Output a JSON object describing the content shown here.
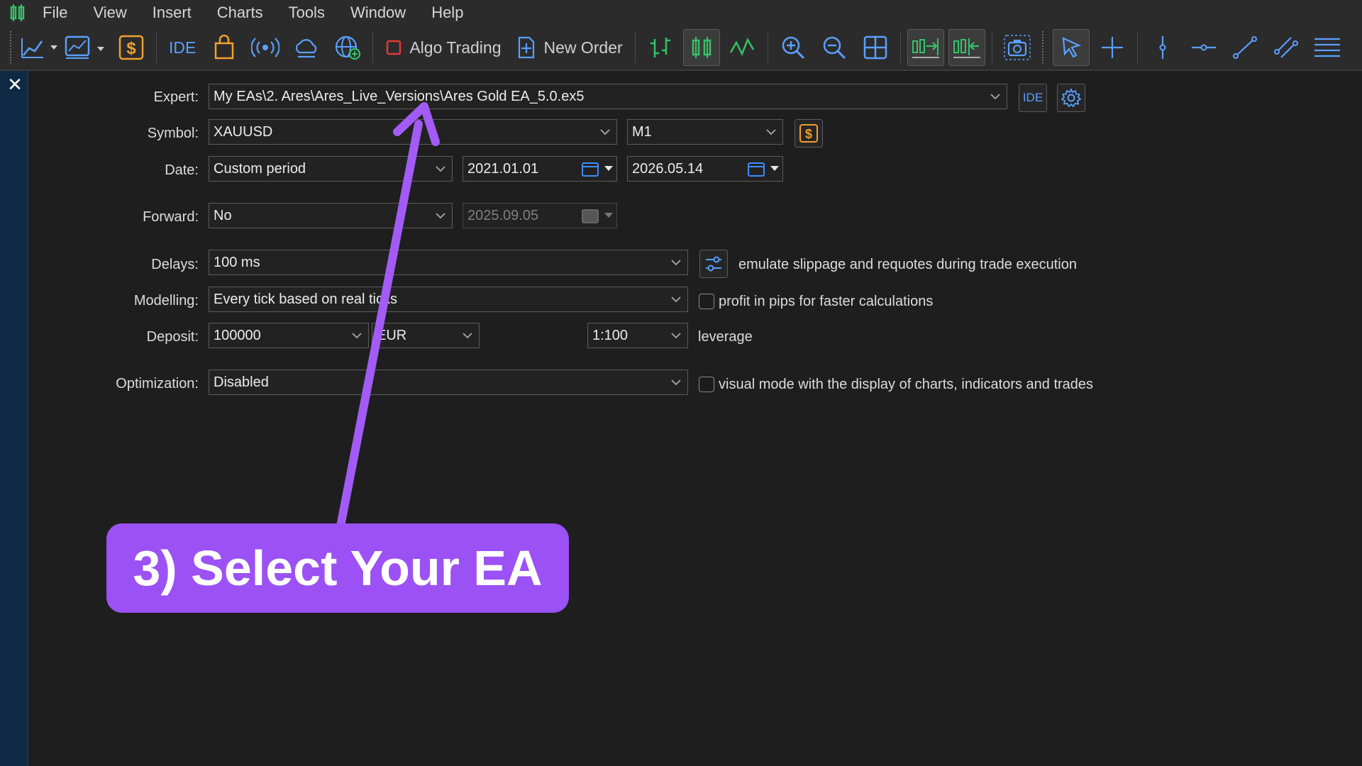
{
  "menu": [
    "File",
    "View",
    "Insert",
    "Charts",
    "Tools",
    "Window",
    "Help"
  ],
  "toolbar": {
    "ide_label": "IDE",
    "algo_label": "Algo Trading",
    "new_order_label": "New Order",
    "icons": [
      "line-chart-icon",
      "chart-dropdown-icon",
      "dollar-icon",
      "ide-icon",
      "market-bag-icon",
      "signals-icon",
      "cloud-icon",
      "vps-globe-icon",
      "algo-trading-icon",
      "new-order-icon",
      "bar-chart-icon",
      "candlestick-icon",
      "line-icon",
      "zoom-in-icon",
      "zoom-out-icon",
      "grid-icon",
      "auto-scroll-icon",
      "chart-shift-icon",
      "screenshot-icon",
      "cursor-icon",
      "crosshair-icon",
      "vertical-line-icon",
      "horizontal-line-icon",
      "trendline-icon",
      "channel-icon",
      "fibonacci-icon"
    ]
  },
  "form": {
    "expert": {
      "label": "Expert:",
      "value": "My EAs\\2. Ares\\Ares_Live_Versions\\Ares Gold EA_5.0.ex5",
      "ide_button": "IDE"
    },
    "symbol": {
      "label": "Symbol:",
      "value": "XAUUSD",
      "timeframe": "M1"
    },
    "date": {
      "label": "Date:",
      "period": "Custom period",
      "from": "2021.01.01",
      "to": "2026.05.14"
    },
    "forward": {
      "label": "Forward:",
      "value": "No",
      "date": "2025.09.05"
    },
    "delays": {
      "label": "Delays:",
      "value": "100 ms",
      "note": "emulate slippage and requotes during trade execution"
    },
    "modelling": {
      "label": "Modelling:",
      "value": "Every tick based on real ticks",
      "checkbox_label": "profit in pips for faster calculations"
    },
    "deposit": {
      "label": "Deposit:",
      "value": "100000",
      "currency": "EUR",
      "leverage": "1:100",
      "leverage_label": "leverage"
    },
    "optimization": {
      "label": "Optimization:",
      "value": "Disabled",
      "checkbox_label": "visual mode with the display of charts, indicators and trades"
    }
  },
  "callout": {
    "text": "3) Select Your EA"
  },
  "colors": {
    "accent": "#9b51f3",
    "toolbar_icon": "#5aa0ff",
    "green": "#35c26a",
    "orange": "#f0a030"
  }
}
